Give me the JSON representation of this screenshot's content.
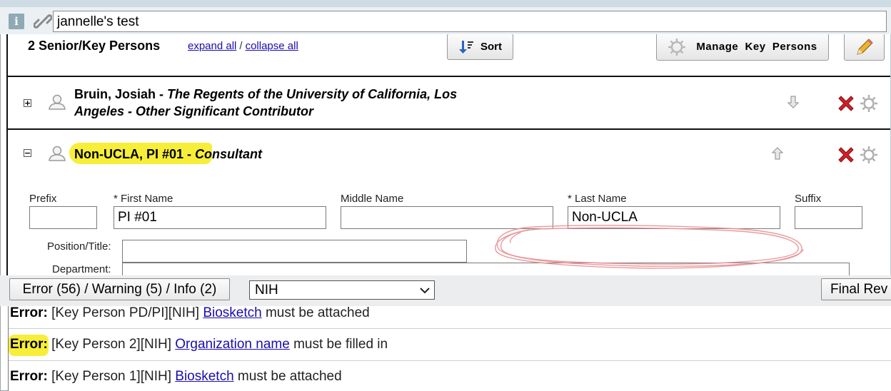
{
  "header": {
    "title_value": "jannelle's test"
  },
  "section": {
    "heading": "2 Senior/Key Persons",
    "expand_all": "expand all",
    "separator": "/",
    "collapse_all": "collapse all",
    "sort_label": "Sort",
    "manage_label": "Manage  Key  Persons"
  },
  "persons": [
    {
      "toggle": "+",
      "name": "Bruin, Josiah",
      "dash": " - ",
      "org_line1": "The Regents of the University of California, Los",
      "org_line2": "Angeles - Other Significant Contributor",
      "arrow": "down"
    },
    {
      "toggle": "−",
      "name": "Non-UCLA, PI #01",
      "dash": " - ",
      "role": "Consultant",
      "arrow": "up"
    }
  ],
  "form": {
    "prefix_label": "Prefix",
    "first_name_label": "* First Name",
    "first_name_value": "PI #01",
    "middle_name_label": "Middle Name",
    "last_name_label": "* Last Name",
    "last_name_value": "Non-UCLA",
    "suffix_label": "Suffix",
    "position_label": "Position/Title:",
    "department_label": "Department:"
  },
  "validation": {
    "summary_button": "Error (56) / Warning (5) / Info (2)",
    "agency_select": "NIH",
    "final_button": "Final Rev",
    "errors": [
      {
        "tag": "Error:",
        "prefix": " [Key Person PD/PI][NIH] ",
        "link": "Biosketch",
        "suffix": " must be attached"
      },
      {
        "tag": "Error:",
        "prefix": " [Key Person 2][NIH] ",
        "link": "Organization name",
        "suffix": " must be filled in"
      },
      {
        "tag": "Error:",
        "prefix": " [Key Person 1][NIH] ",
        "link": "Biosketch",
        "suffix": " must be attached"
      }
    ]
  },
  "colors": {
    "highlight": "#f7ee3a",
    "link": "#1a0dab",
    "delete": "#d0202a",
    "scribble": "#e88f91"
  }
}
